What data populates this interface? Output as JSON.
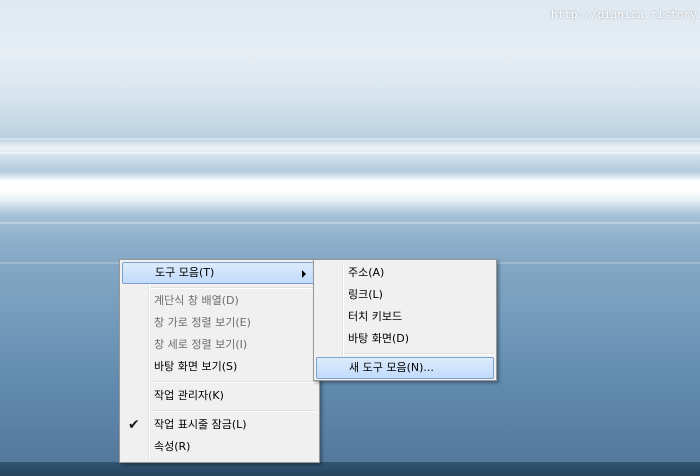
{
  "watermark": "http://pianica.tistory.com",
  "context_menu": {
    "items": [
      {
        "label": "도구 모음(T)",
        "has_submenu": true,
        "highlighted": true
      },
      {
        "label": "계단식 창 배열(D)",
        "disabled": true
      },
      {
        "label": "창 가로 정렬 보기(E)",
        "disabled": true
      },
      {
        "label": "창 세로 정렬 보기(I)",
        "disabled": true
      },
      {
        "label": "바탕 화면 보기(S)"
      },
      {
        "label": "작업 관리자(K)"
      },
      {
        "label": "작업 표시줄 잠금(L)",
        "checked": true
      },
      {
        "label": "속성(R)"
      }
    ],
    "check_glyph": "✔"
  },
  "toolbar_submenu": {
    "items": [
      {
        "label": "주소(A)"
      },
      {
        "label": "링크(L)"
      },
      {
        "label": "터치 키보드"
      },
      {
        "label": "바탕 화면(D)"
      },
      {
        "label": "새 도구 모음(N)...",
        "highlighted": true
      }
    ]
  }
}
